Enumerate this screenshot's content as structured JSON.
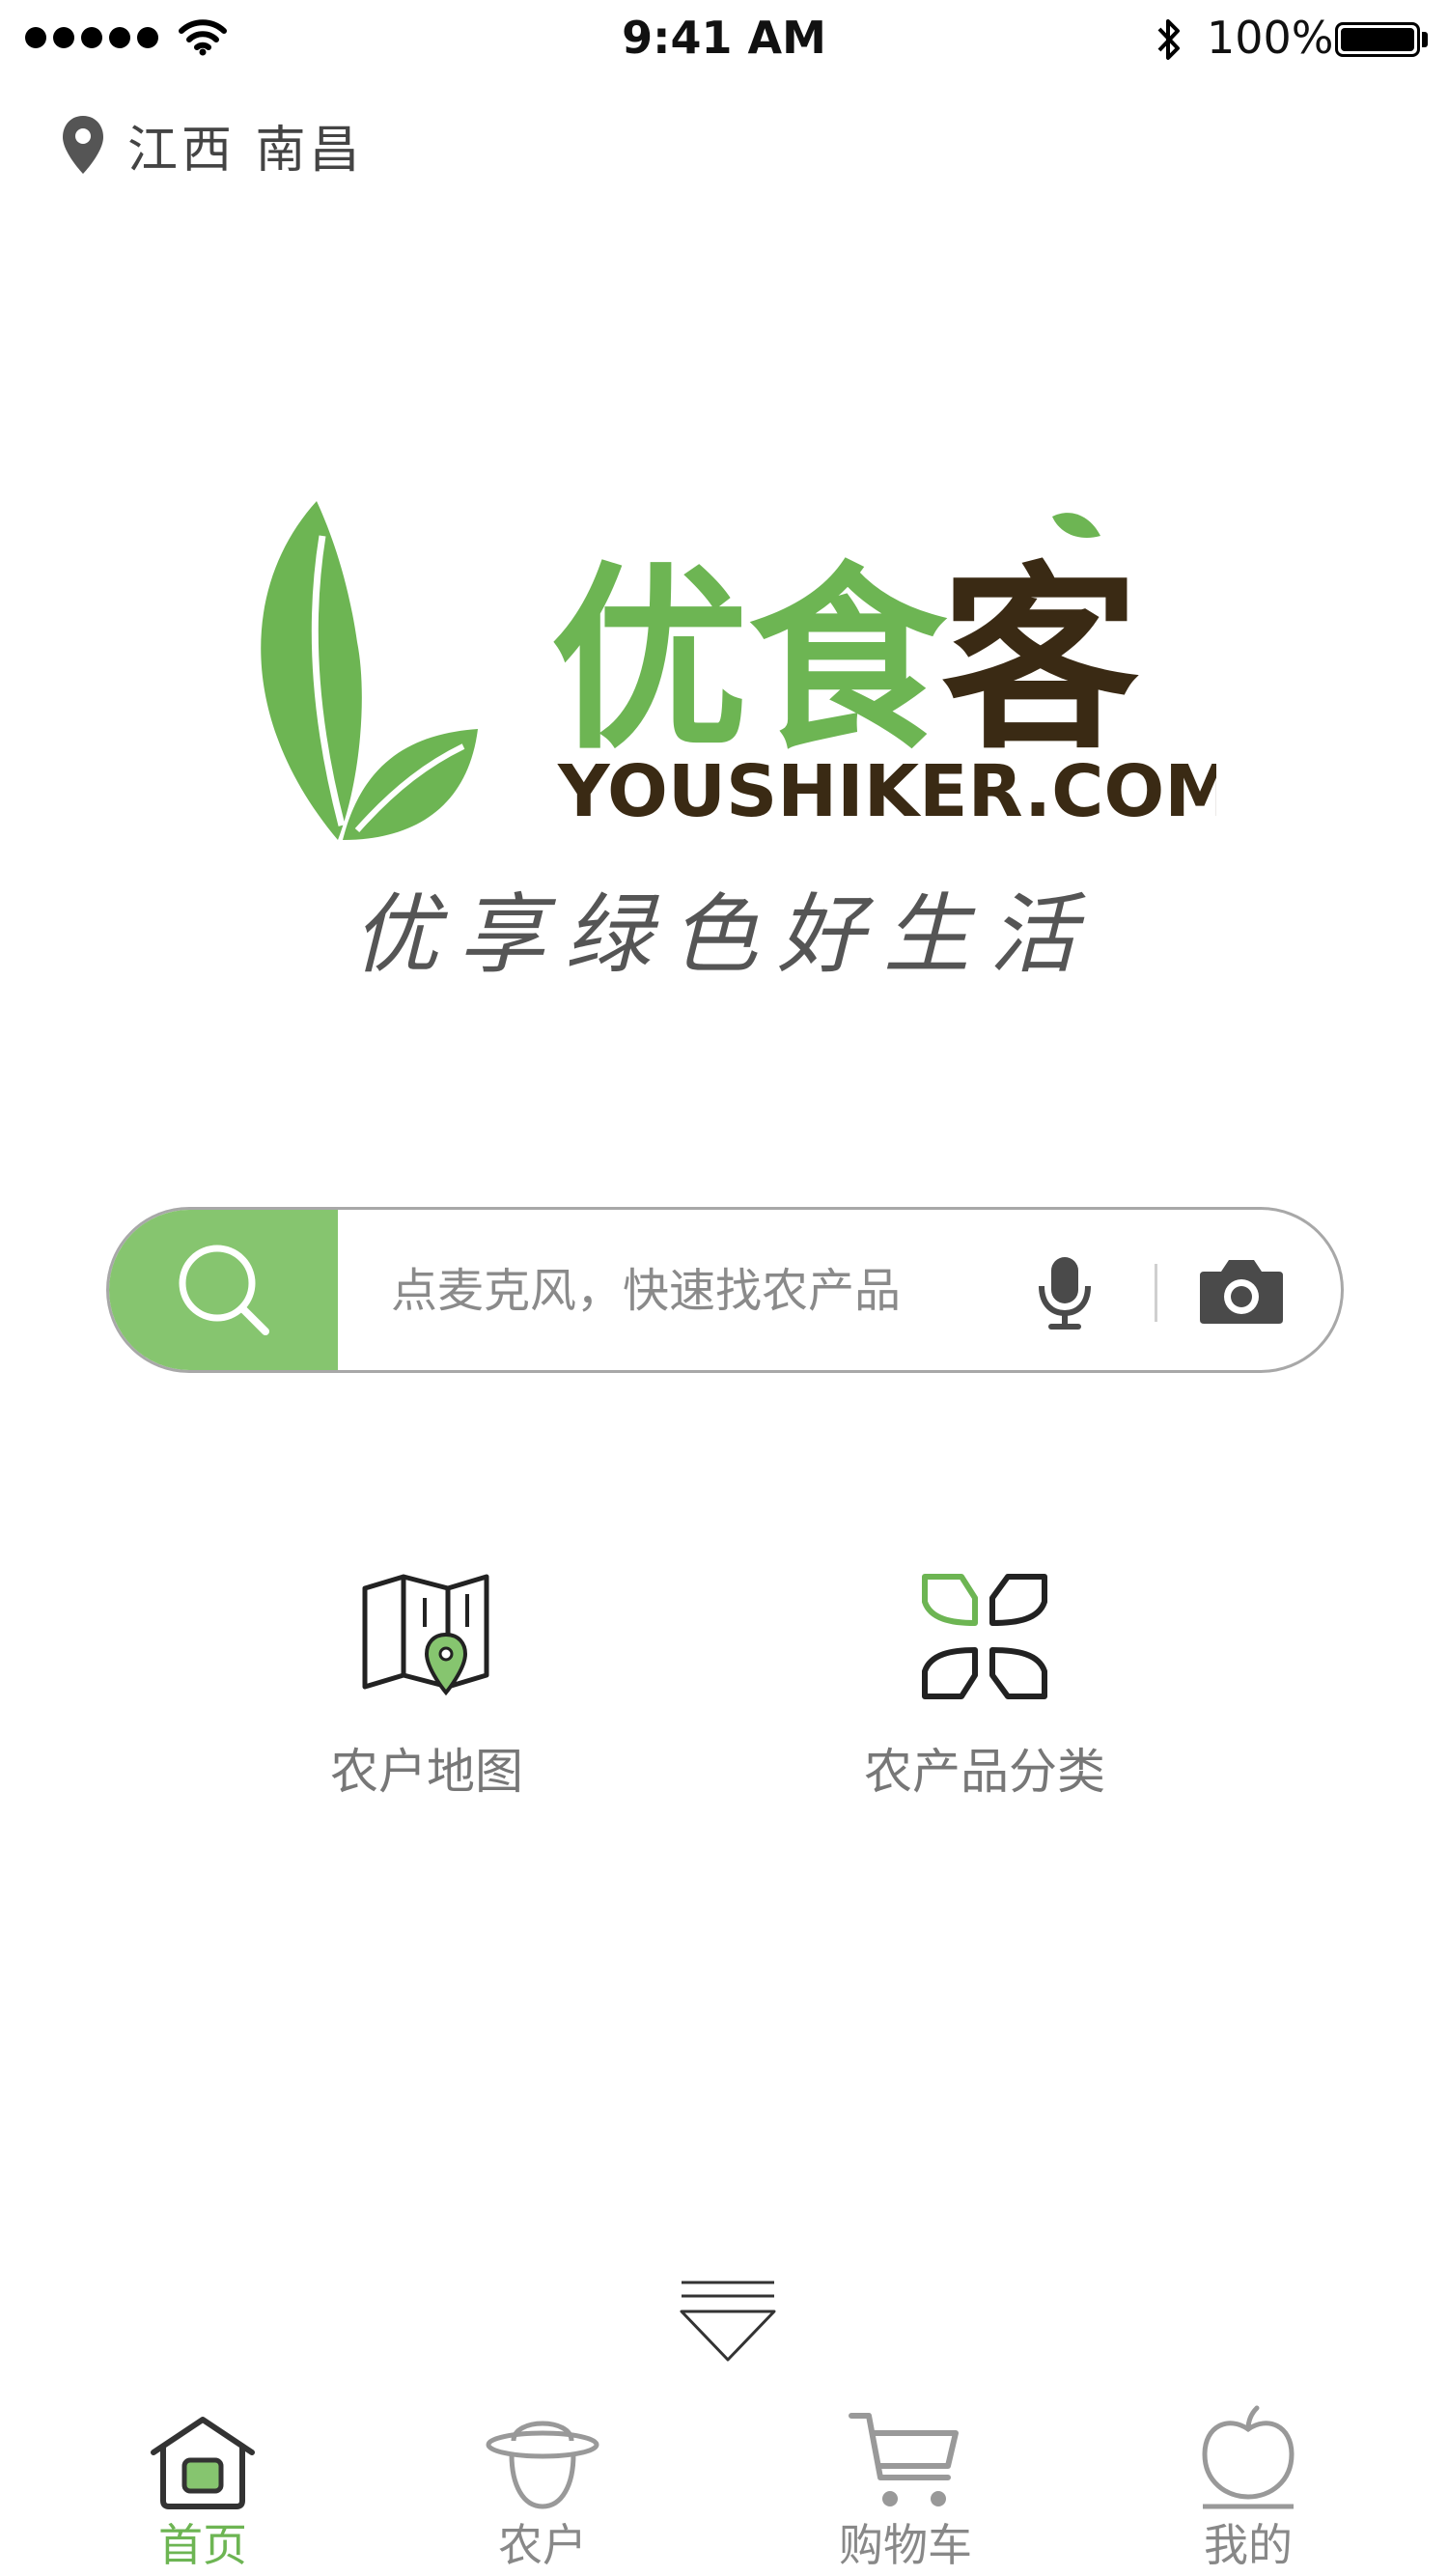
{
  "status_bar": {
    "time": "9:41 AM",
    "battery": "100%",
    "icons": [
      "signal-icon",
      "wifi-icon",
      "bluetooth-icon",
      "battery-icon"
    ]
  },
  "location": {
    "text": "江西 南昌",
    "icon": "location-pin-icon"
  },
  "logo": {
    "name": "优食客",
    "domain": "YOUSHIKER.COM",
    "slogan": "优享绿色好生活"
  },
  "search": {
    "placeholder": "点麦克风，快速找农产品",
    "icons": [
      "search-icon",
      "microphone-icon",
      "camera-icon"
    ]
  },
  "entries": [
    {
      "label": "农户地图",
      "icon": "map-pin-icon"
    },
    {
      "label": "农产品分类",
      "icon": "category-icon"
    }
  ],
  "tabs": [
    {
      "label": "首页",
      "icon": "home-icon",
      "active": true
    },
    {
      "label": "农户",
      "icon": "farmer-icon",
      "active": false
    },
    {
      "label": "购物车",
      "icon": "cart-icon",
      "active": false
    },
    {
      "label": "我的",
      "icon": "apple-icon",
      "active": false
    }
  ],
  "colors": {
    "accent": "#6db553",
    "search_button": "#86c56f",
    "dark_brown": "#3a2a14"
  }
}
